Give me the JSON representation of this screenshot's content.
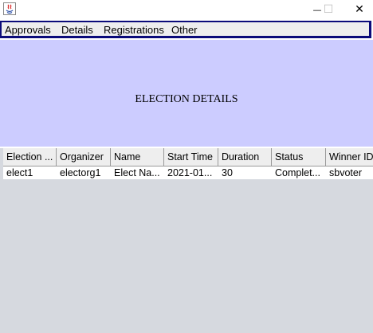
{
  "window": {
    "minimize_glyph": "—",
    "maximize_glyph": "☐",
    "close_glyph": "✕"
  },
  "menu": {
    "items": [
      {
        "label": "Approvals"
      },
      {
        "label": "Details"
      },
      {
        "label": "Registrations"
      },
      {
        "label": "Other"
      }
    ]
  },
  "banner": {
    "title": "ELECTION DETAILS",
    "color": "#ccccff"
  },
  "table": {
    "columns": [
      "Election ...",
      "Organizer",
      "Name",
      "Start Time",
      "Duration",
      "Status",
      "Winner ID"
    ],
    "rows": [
      [
        "elect1",
        "electorg1",
        "Elect Na...",
        "2021-01...",
        "30",
        "Complet...",
        "sbvoter"
      ]
    ]
  },
  "colors": {
    "frame_border": "#0b0b7a",
    "table_background": "#d6d9df"
  }
}
